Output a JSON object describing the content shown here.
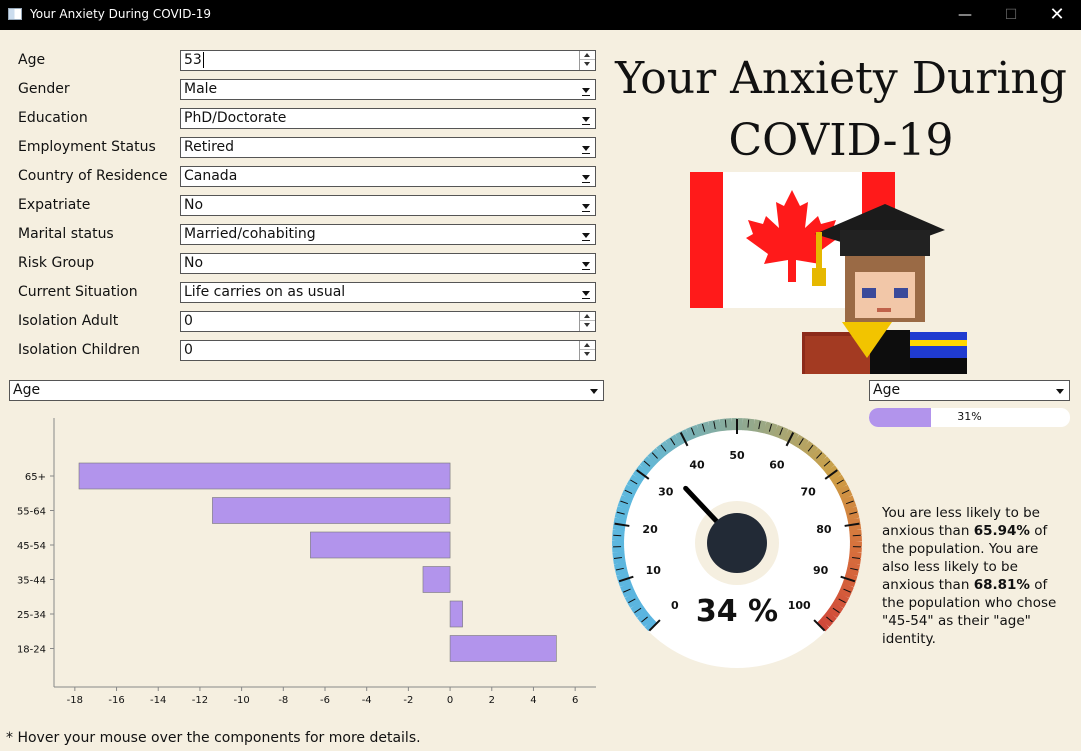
{
  "window": {
    "title": "Your Anxiety During COVID-19",
    "minimize_icon": "minimize-icon",
    "maximize_icon": "maximize-icon",
    "close_icon": "close-icon"
  },
  "form": {
    "age": {
      "label": "Age",
      "value": "53"
    },
    "gender": {
      "label": "Gender",
      "value": "Male"
    },
    "education": {
      "label": "Education",
      "value": "PhD/Doctorate"
    },
    "employment": {
      "label": "Employment Status",
      "value": "Retired"
    },
    "country": {
      "label": "Country of Residence",
      "value": "Canada"
    },
    "expatriate": {
      "label": "Expatriate",
      "value": "No"
    },
    "marital": {
      "label": "Marital status",
      "value": "Married/cohabiting"
    },
    "risk": {
      "label": "Risk Group",
      "value": "No"
    },
    "situation": {
      "label": "Current Situation",
      "value": "Life carries on as usual"
    },
    "iso_adult": {
      "label": "Isolation Adult",
      "value": "0"
    },
    "iso_children": {
      "label": "Isolation Children",
      "value": "0"
    }
  },
  "title": {
    "line1": "Your Anxiety During",
    "line2": "COVID-19"
  },
  "chart_selector": {
    "value": "Age"
  },
  "right_selector": {
    "value": "Age"
  },
  "progress": {
    "value": 0.31,
    "label": "31%"
  },
  "gauge": {
    "value": 34,
    "label": "34 %",
    "min": 0,
    "max": 100,
    "ticks": [
      "0",
      "10",
      "20",
      "30",
      "40",
      "50",
      "60",
      "70",
      "80",
      "90",
      "100"
    ]
  },
  "description": {
    "part1": "You are less likely to be anxious than ",
    "pct1": "65.94%",
    "part2": " of the population. You are also less likely to be anxious than ",
    "pct2": "68.81%",
    "part3": " of the population who chose \"45-54\" as their \"age\" identity."
  },
  "footer": "* Hover your mouse over the components for more details.",
  "colors": {
    "bar": "#b294ec",
    "background": "#f5efe0",
    "gauge_blue": "#5ab4e0",
    "gauge_red": "#d0483a"
  },
  "chart_data": {
    "type": "bar",
    "orientation": "horizontal",
    "categories": [
      "65+",
      "55-64",
      "45-54",
      "35-44",
      "25-34",
      "18-24"
    ],
    "values": [
      -17.8,
      -11.4,
      -6.7,
      -1.3,
      0.6,
      5.1
    ],
    "xlim": [
      -19,
      7
    ],
    "xticks": [
      "-18",
      "-16",
      "-14",
      "-12",
      "-10",
      "-8",
      "-6",
      "-4",
      "-2",
      "0",
      "2",
      "4",
      "6"
    ],
    "color": "#b294ec"
  }
}
